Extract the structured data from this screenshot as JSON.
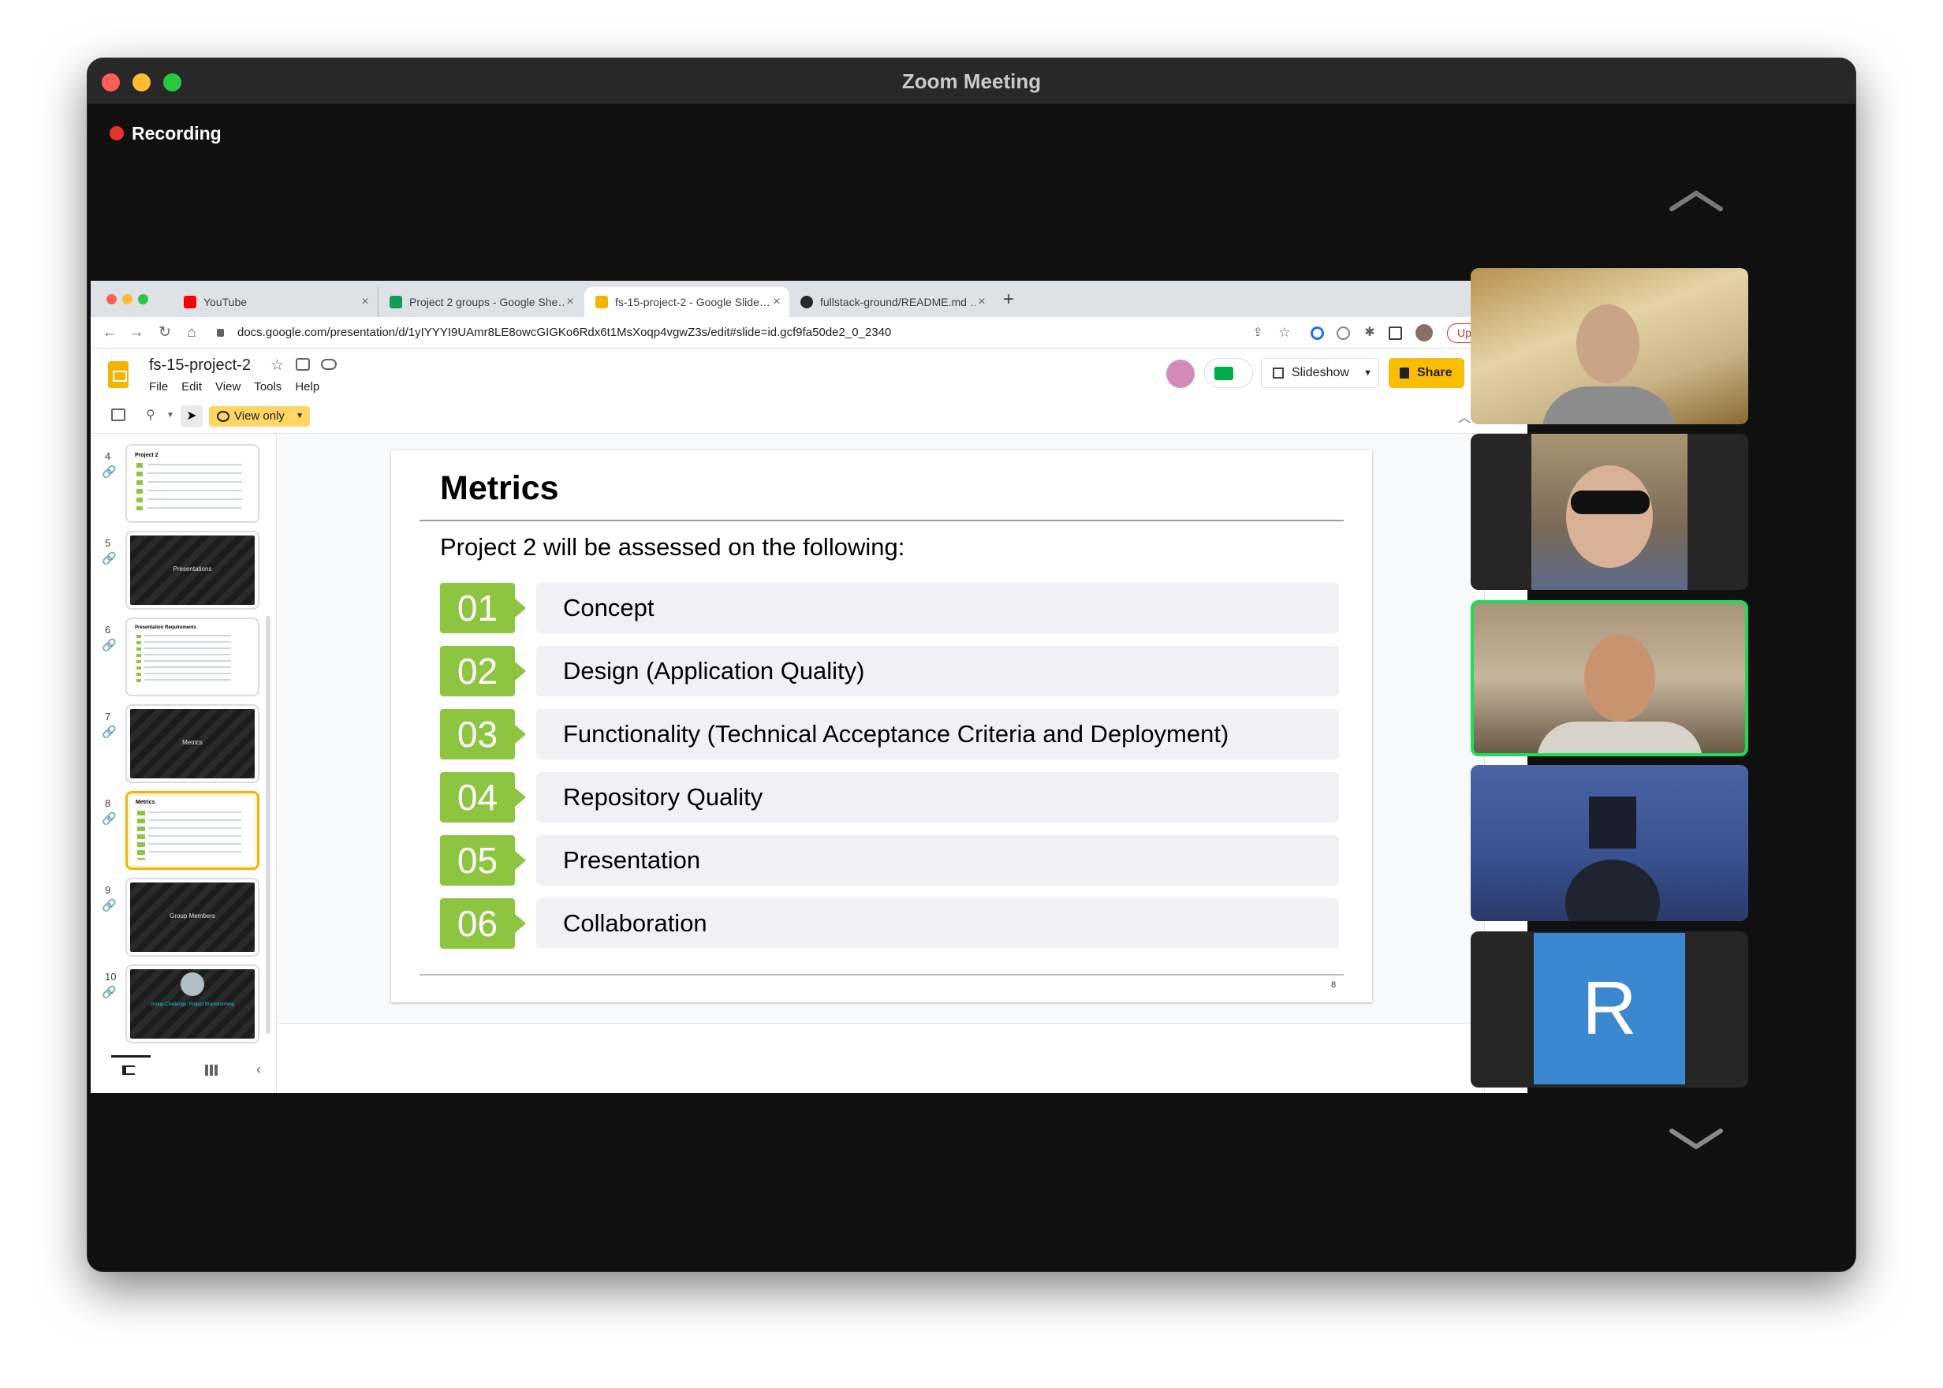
{
  "zoom": {
    "window_title": "Zoom Meeting",
    "recording_label": "Recording"
  },
  "browser": {
    "tabs": [
      {
        "label": "YouTube",
        "icon": "youtube-icon",
        "active": false
      },
      {
        "label": "Project 2 groups - Google She…",
        "icon": "sheets-icon",
        "active": false
      },
      {
        "label": "fs-15-project-2 - Google Slide…",
        "icon": "slides-icon",
        "active": true
      },
      {
        "label": "fullstack-ground/README.md …",
        "icon": "github-icon",
        "active": false
      }
    ],
    "url": "docs.google.com/presentation/d/1yIYYYI9UAmr8LE8owcGIGKo6Rdx6t1MsXoqp4vgwZ3s/edit#slide=id.gcf9fa50de2_0_2340",
    "update_label": "Update"
  },
  "slides_app": {
    "doc_title": "fs-15-project-2",
    "menus": [
      "File",
      "Edit",
      "View",
      "Tools",
      "Help"
    ],
    "slideshow_label": "Slideshow",
    "share_label": "Share",
    "view_only_label": "View only"
  },
  "filmstrip": [
    {
      "num": "4",
      "theme": "light",
      "title": "Project 2"
    },
    {
      "num": "5",
      "theme": "dark",
      "title": "Presentations"
    },
    {
      "num": "6",
      "theme": "light",
      "title": "Presentation Requirements"
    },
    {
      "num": "7",
      "theme": "dark",
      "title": "Metrics"
    },
    {
      "num": "8",
      "theme": "light",
      "title": "Metrics",
      "selected": true
    },
    {
      "num": "9",
      "theme": "dark",
      "title": "Group Members"
    },
    {
      "num": "10",
      "theme": "dark",
      "title": "Group Challenge: Project Brainstorming"
    }
  ],
  "slide": {
    "title": "Metrics",
    "subtitle": "Project 2 will be assessed on the following:",
    "items": [
      {
        "num": "01",
        "label": "Concept"
      },
      {
        "num": "02",
        "label": "Design (Application Quality)"
      },
      {
        "num": "03",
        "label": "Functionality (Technical Acceptance Criteria and Deployment)"
      },
      {
        "num": "04",
        "label": "Repository Quality"
      },
      {
        "num": "05",
        "label": "Presentation"
      },
      {
        "num": "06",
        "label": "Collaboration"
      }
    ],
    "page_number": "8",
    "accent_color": "#8dc540"
  },
  "participants": [
    {
      "kind": "video"
    },
    {
      "kind": "video"
    },
    {
      "kind": "video",
      "active_speaker": true
    },
    {
      "kind": "video"
    },
    {
      "kind": "avatar",
      "initial": "R",
      "color": "#3b87d0"
    }
  ]
}
